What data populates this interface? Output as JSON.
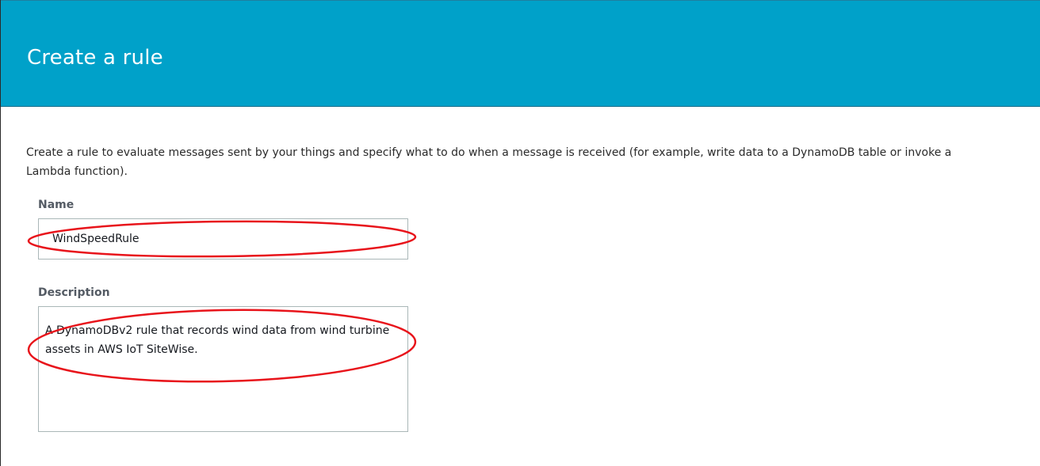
{
  "header": {
    "title": "Create a rule"
  },
  "intro": {
    "text": "Create a rule to evaluate messages sent by your things and specify what to do when a message is received (for example, write data to a DynamoDB table or invoke a Lambda function)."
  },
  "form": {
    "name": {
      "label": "Name",
      "value": "WindSpeedRule"
    },
    "description": {
      "label": "Description",
      "value": "A DynamoDBv2 rule that records wind data from wind turbine assets in AWS IoT SiteWise."
    }
  },
  "colors": {
    "header_background": "#00a1c9",
    "annotation": "#e8141b"
  }
}
